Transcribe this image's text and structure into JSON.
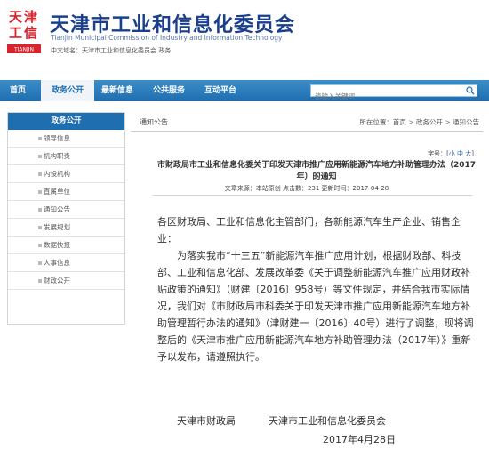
{
  "header": {
    "logo_text": "天津",
    "title": "天津市工业和信息化委员会",
    "subtitle": "Tianjin Municipal Commission of Industry and Information Technology",
    "links": "中文域名：天津市工业和信息化委员会.政务"
  },
  "nav": {
    "items": [
      "首页",
      "政务公开",
      "最新信息",
      "公共服务",
      "互动平台"
    ],
    "search_placeholder": "请输入关键词"
  },
  "sidebar": {
    "title": "政务公开",
    "items": [
      "领导信息",
      "机构职责",
      "内设机构",
      "直属单位",
      "通知公告",
      "发展规划",
      "数据快报",
      "人事信息",
      "财政公开"
    ]
  },
  "main": {
    "section_title": "通知公告",
    "breadcrumb": {
      "label": "所在位置：",
      "items": [
        "首页",
        "政务公开",
        "通知公告"
      ],
      "separator": ">"
    },
    "font_size": {
      "label": "字号：",
      "options": [
        "小",
        "中",
        "大"
      ]
    },
    "doc_title": "市财政局市工业和信息化委关于印发天津市推广应用新能源汽车地方补助管理办法（2017年）的通知",
    "meta": "文章来源：本站原创 点击数：231 更新时间：2017-04-28",
    "paragraphs": [
      "各区财政局、工业和信息化主管部门，各新能源汽车生产企业、销售企业：",
      "为落实我市“十三五”新能源汽车推广应用计划，根据财政部、科技部、工业和信息化部、发展改革委《关于调整新能源汽车推广应用财政补贴政策的通知》（财建〔2016〕958号）等文件规定，并结合我市实际情况，我们对《市财政局市科委关于印发天津市推广应用新能源汽车地方补助管理暂行办法的通知》（津财建一〔2016〕40号）进行了调整，现将调整后的《天津市推广应用新能源汽车地方补助管理办法（2017年）》重新予以发布，请遵照执行。"
    ],
    "signatures": [
      "天津市财政局",
      "天津市工业和信息化委员会"
    ],
    "date": "2017年4月28日"
  },
  "colors": {
    "nav_blue": "#1f6eb0",
    "title_blue": "#1a3f8c",
    "logo_red": "#d9232d"
  }
}
